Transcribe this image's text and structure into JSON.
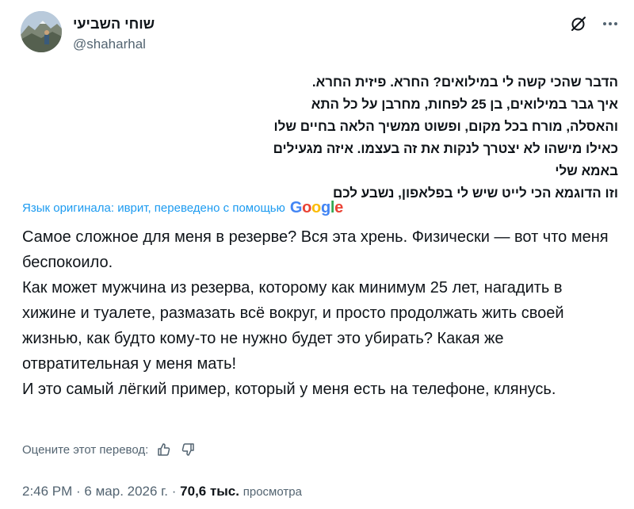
{
  "author": {
    "display_name": "שוחי השביעי",
    "handle": "@shaharhal"
  },
  "header_icons": {
    "grok": "grok-icon",
    "more": "more-icon"
  },
  "post": {
    "original_lines": [
      "הדבר שהכי קשה לי במילואים? החרא. פיזית החרא.",
      "איך גבר במילואים, בן 25 לפחות, מחרבן על כל התא והאסלה, מורח בכל מקום, ופשוט ממשיך הלאה בחיים שלו כאילו מישהו לא יצטרך לנקות את זה בעצמו. איזה מגעילים באמא שלי",
      "וזו הדוגמא הכי לייט שיש לי בפלאפון, נשבע לכם"
    ],
    "translation_notice": "Язык оригинала: иврит, переведено с помощью",
    "translation_provider": "Google",
    "translated_lines": [
      "Самое сложное для меня в резерве? Вся эта хрень. Физически — вот что меня беспокоило.",
      "Как может мужчина из резерва, которому как минимум 25 лет, нагадить в хижине и туалете, размазать всё вокруг, и просто продолжать жить своей жизнью, как будто кому-то не нужно будет это убирать? Какая же отвратительная у меня мать!",
      "И это самый лёгкий пример, который у меня есть на телефоне, клянусь."
    ],
    "rate_label": "Оцените этот перевод:",
    "time": "2:46 PM",
    "separator": " · ",
    "date": "6 мар. 2026 г.",
    "views_count": "70,6 тыс.",
    "views_label": "просмотра"
  },
  "colors": {
    "link": "#1d9bf0",
    "muted": "#536471",
    "text": "#0f1419"
  }
}
